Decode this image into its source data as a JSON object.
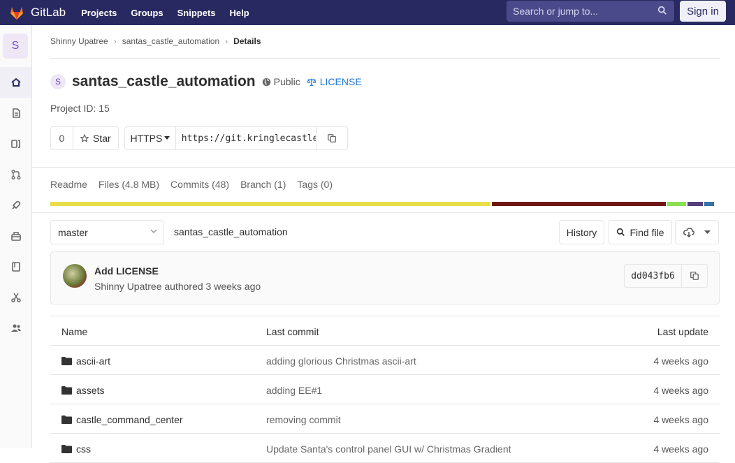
{
  "topnav": {
    "brand": "GitLab",
    "links": [
      "Projects",
      "Groups",
      "Snippets",
      "Help"
    ],
    "search_placeholder": "Search or jump to...",
    "signin": "Sign in"
  },
  "sidebar": {
    "avatar_letter": "S",
    "items": [
      {
        "icon": "home-icon",
        "active": true
      },
      {
        "icon": "file-icon"
      },
      {
        "icon": "issues-icon"
      },
      {
        "icon": "merge-request-icon"
      },
      {
        "icon": "rocket-icon"
      },
      {
        "icon": "package-icon"
      },
      {
        "icon": "wiki-icon"
      },
      {
        "icon": "snippet-icon"
      },
      {
        "icon": "members-icon"
      }
    ]
  },
  "breadcrumb": {
    "items": [
      "Shinny Upatree",
      "santas_castle_automation",
      "Details"
    ]
  },
  "project": {
    "avatar_letter": "S",
    "title": "santas_castle_automation",
    "visibility": "Public",
    "license": "LICENSE",
    "id_text": "Project ID: 15"
  },
  "actions": {
    "star_count": "0",
    "star_label": "Star",
    "protocol": "HTTPS",
    "url": "https://git.kringlecastle.com/Upatree/santas_castle_automation.git"
  },
  "stats": [
    "Readme",
    "Files (4.8 MB)",
    "Commits (48)",
    "Branch (1)",
    "Tags (0)"
  ],
  "languages": [
    {
      "pct": 66.9,
      "color": "#e8de4a"
    },
    {
      "pct": 26.4,
      "color": "#701516"
    },
    {
      "pct": 2.9,
      "color": "#89e051"
    },
    {
      "pct": 2.3,
      "color": "#563d7c"
    },
    {
      "pct": 1.5,
      "color": "#3572a5"
    }
  ],
  "repo": {
    "branch": "master",
    "path": "santas_castle_automation",
    "history": "History",
    "find_file": "Find file"
  },
  "last_commit": {
    "title": "Add LICENSE",
    "author_line": "Shinny Upatree authored 3 weeks ago",
    "sha": "dd043fb6"
  },
  "tree": {
    "headers": {
      "name": "Name",
      "last_commit": "Last commit",
      "last_update": "Last update"
    },
    "rows": [
      {
        "name": "ascii-art",
        "msg": "adding glorious Christmas ascii-art",
        "date": "4 weeks ago"
      },
      {
        "name": "assets",
        "msg": "adding EE#1",
        "date": "4 weeks ago"
      },
      {
        "name": "castle_command_center",
        "msg": "removing commit",
        "date": "4 weeks ago"
      },
      {
        "name": "css",
        "msg": "Update Santa's control panel GUI w/ Christmas Gradient",
        "date": "4 weeks ago"
      }
    ]
  }
}
